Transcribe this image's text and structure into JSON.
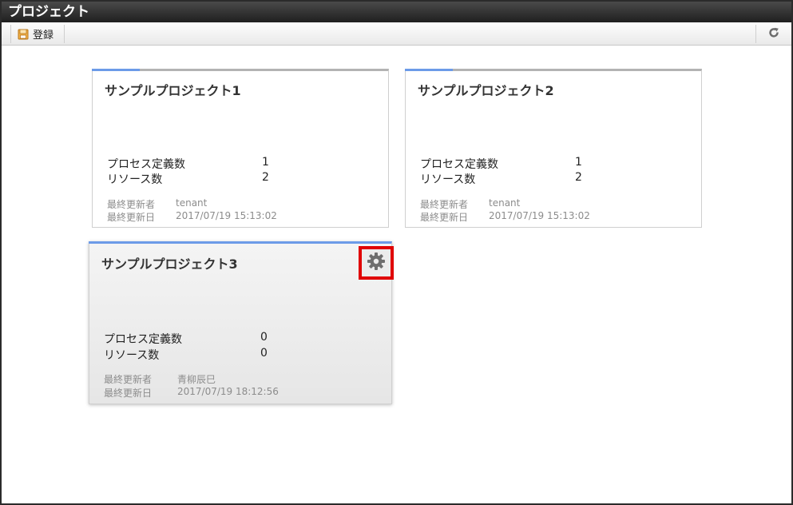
{
  "window": {
    "title": "プロジェクト"
  },
  "toolbar": {
    "register_label": "登録",
    "register_icon": "register-icon",
    "refresh_icon": "refresh-icon"
  },
  "projects": [
    {
      "name": "サンプルプロジェクト1",
      "process_label": "プロセス定義数",
      "process_count": "1",
      "resource_label": "リソース数",
      "resource_count": "2",
      "updater_label": "最終更新者",
      "updater": "tenant",
      "updated_label": "最終更新日",
      "updated": "2017/07/19 15:13:02"
    },
    {
      "name": "サンプルプロジェクト2",
      "process_label": "プロセス定義数",
      "process_count": "1",
      "resource_label": "リソース数",
      "resource_count": "2",
      "updater_label": "最終更新者",
      "updater": "tenant",
      "updated_label": "最終更新日",
      "updated": "2017/07/19 15:13:02"
    },
    {
      "name": "サンプルプロジェクト3",
      "process_label": "プロセス定義数",
      "process_count": "0",
      "resource_label": "リソース数",
      "resource_count": "0",
      "updater_label": "最終更新者",
      "updater": "青柳辰巳",
      "updated_label": "最終更新日",
      "updated": "2017/07/19 18:12:56",
      "settings_icon": "gear-icon"
    }
  ],
  "colors": {
    "accent": "#6c9be8",
    "highlight": "#e00000",
    "titlebar": "#2b2b2b"
  }
}
